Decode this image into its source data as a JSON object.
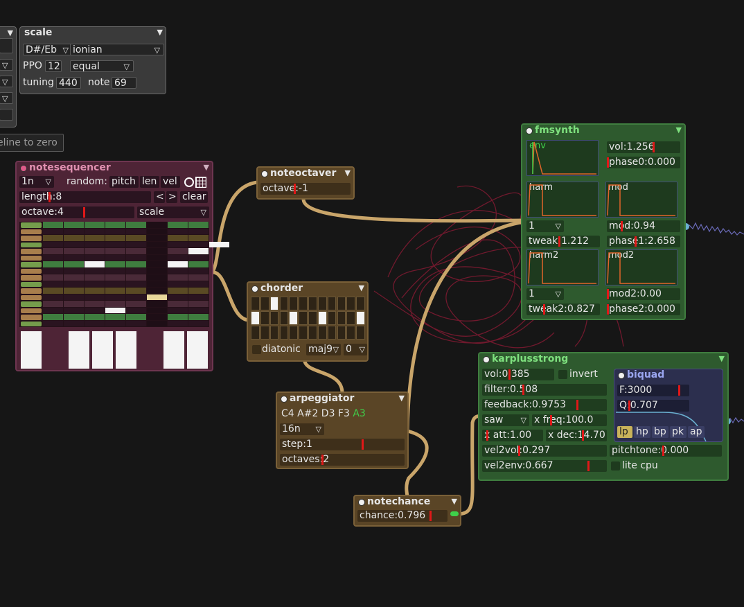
{
  "scale": {
    "title": "scale",
    "root": "D#/Eb",
    "mode": "ionian",
    "ppo_label": "PPO",
    "ppo_value": "12",
    "temperament": "equal",
    "tuning_label": "tuning",
    "tuning_value": "440",
    "note_label": "note",
    "note_value": "69"
  },
  "left_button": {
    "label": "eline to zero"
  },
  "notesequencer": {
    "title": "notesequencer",
    "interval": "1n",
    "random_label": "random:",
    "random_pitch": "pitch",
    "random_len": "len",
    "random_vel": "vel",
    "length": "length:8",
    "prev": "<",
    "next": ">",
    "clear": "clear",
    "octave": "octave:4",
    "octave_value": 0.5,
    "mode": "scale"
  },
  "noteoctaver": {
    "title": "noteoctaver",
    "octave": "octave:-1",
    "octave_value": 0.33
  },
  "chorder": {
    "title": "chorder",
    "diatonic": "diatonic",
    "chord": "maj9",
    "inversion": "0"
  },
  "arpeggiator": {
    "title": "arpeggiator",
    "notes": "C4 A#2 D3 F3",
    "current_note": "A3",
    "interval": "16n",
    "step": "step:1",
    "step_value": 0.6,
    "octaves": "octaves:2",
    "octaves_value": 0.33
  },
  "notechance": {
    "title": "notechance",
    "chance": "chance:0.796",
    "chance_value": 0.796
  },
  "fmsynth": {
    "title": "fmsynth",
    "env": "env",
    "vol": "vol:1.256",
    "phase0": "phase0:0.000",
    "harm": "harm",
    "mod": "mod",
    "harm_select": "1",
    "mod_value": "mod:0.94",
    "tweak": "tweak:1.212",
    "phase1": "phase1:2.658",
    "harm2": "harm2",
    "mod2": "mod2",
    "harm2_select": "1",
    "mod2_value": "mod2:0.00",
    "tweak2": "tweak2:0.827",
    "phase2": "phase2:0.000"
  },
  "karplusstrong": {
    "title": "karplusstrong",
    "vol": "vol:0.385",
    "invert": "invert",
    "filter": "filter:0.508",
    "feedback": "feedback:0.9753",
    "source": "saw",
    "xfreq": "x freq:100.0",
    "xatt": "x att:1.00",
    "xdec": "x dec:14.70",
    "vel2vol": "vel2vol:0.297",
    "pitchtone": "pitchtone:0.000",
    "vel2env": "vel2env:0.667",
    "litecpu": "lite cpu"
  },
  "biquad": {
    "title": "biquad",
    "freq": "F:3000",
    "q": "Q:0.707",
    "types": [
      "lp",
      "hp",
      "bp",
      "pk",
      "ap"
    ]
  },
  "colors": {
    "cable": "#c9a56a",
    "fm_cable": "#8a1e35",
    "accent_red": "#e01818"
  }
}
